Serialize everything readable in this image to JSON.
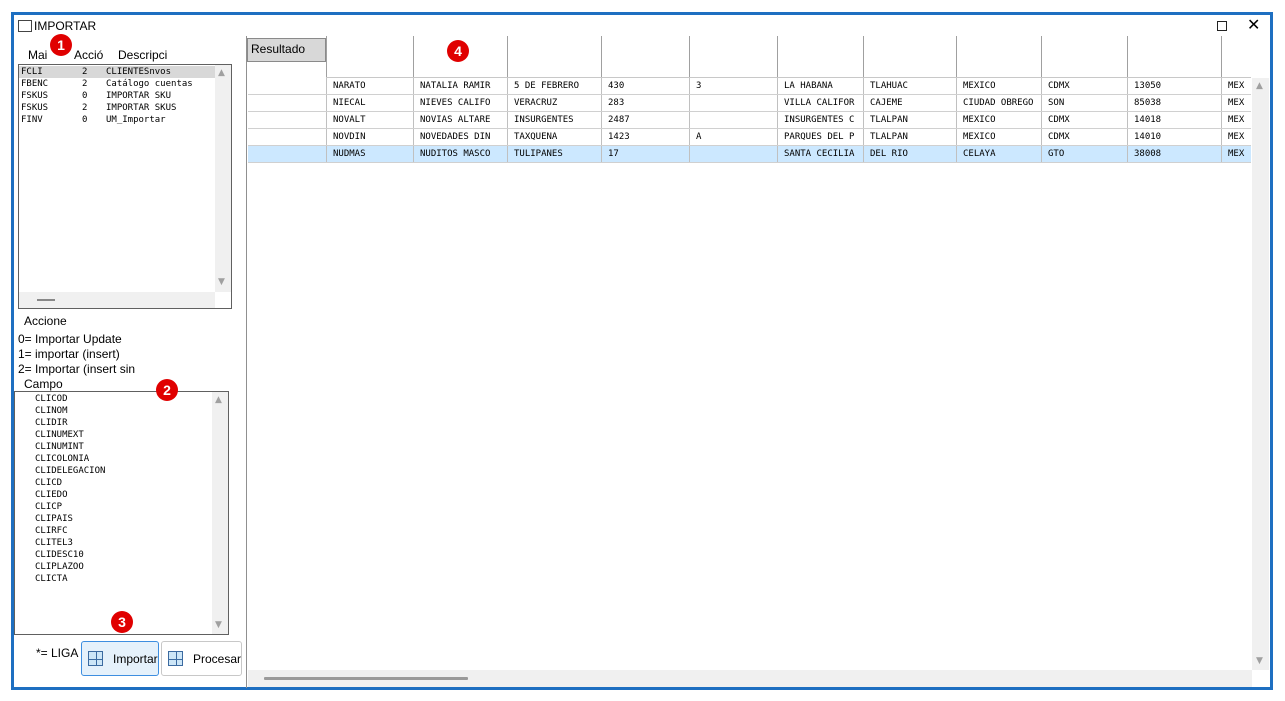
{
  "window": {
    "title": "IMPORTAR"
  },
  "markers": [
    "1",
    "2",
    "3",
    "4"
  ],
  "list_headers": [
    "Mai",
    "Acció",
    "Descripci"
  ],
  "list_rows": [
    {
      "mai": "FCLI",
      "accion": "2",
      "descripcion": "CLIENTESnvos"
    },
    {
      "mai": "FBENC",
      "accion": "2",
      "descripcion": "Catálogo cuentas"
    },
    {
      "mai": "FSKUS",
      "accion": "0",
      "descripcion": "IMPORTAR SKU"
    },
    {
      "mai": "FSKUS",
      "accion": "2",
      "descripcion": "IMPORTAR SKUS"
    },
    {
      "mai": "FINV",
      "accion": "0",
      "descripcion": "UM_Importar"
    }
  ],
  "acciones": {
    "title": "Accione",
    "lines": [
      "0= Importar Update",
      "1= importar (insert)",
      "2= Importar (insert sin"
    ]
  },
  "campo": {
    "title": "Campo",
    "items": [
      "CLICOD",
      "CLINOM",
      "CLIDIR",
      "CLINUMEXT",
      "CLINUMINT",
      "CLICOLONIA",
      "CLIDELEGACION",
      "CLICD",
      "CLIEDO",
      "CLICP",
      "CLIPAIS",
      "CLIRFC",
      "CLITEL3",
      "CLIDESC10",
      "CLIPLAZOO",
      "CLICTA"
    ]
  },
  "liga_label": "*= LIGA",
  "buttons": {
    "importar": "Importar",
    "procesar": "Procesar"
  },
  "grid": {
    "corner_label": "Resultado",
    "rows": [
      [
        "",
        "NARATO",
        "NATALIA RAMIR",
        "5 DE FEBRERO",
        "430",
        "3",
        "LA HABANA",
        "TLAHUAC",
        "MEXICO",
        "CDMX",
        "13050",
        "MEX"
      ],
      [
        "",
        "NIECAL",
        "NIEVES CALIFO",
        "VERACRUZ",
        "283",
        "",
        "VILLA CALIFOR",
        "CAJEME",
        "CIUDAD OBREGO",
        "SON",
        "85038",
        "MEX"
      ],
      [
        "",
        "NOVALT",
        "NOVIAS ALTARE",
        "INSURGENTES",
        "2487",
        "",
        "INSURGENTES C",
        "TLALPAN",
        "MEXICO",
        "CDMX",
        "14018",
        "MEX"
      ],
      [
        "",
        "NOVDIN",
        "NOVEDADES DIN",
        "TAXQUENA",
        "1423",
        "A",
        "PARQUES DEL P",
        "TLALPAN",
        "MEXICO",
        "CDMX",
        "14010",
        "MEX"
      ],
      [
        "",
        "NUDMAS",
        "NUDITOS MASCO",
        "TULIPANES",
        "17",
        "",
        "SANTA CECILIA",
        "DEL RIO",
        "CELAYA",
        "GTO",
        "38008",
        "MEX"
      ]
    ],
    "selected_row": 4
  },
  "colors": {
    "border_blue": "#1e6fc1",
    "marker_red": "#e00000",
    "selected_row": "#cce8ff",
    "button_active": "#e5f1fb"
  }
}
